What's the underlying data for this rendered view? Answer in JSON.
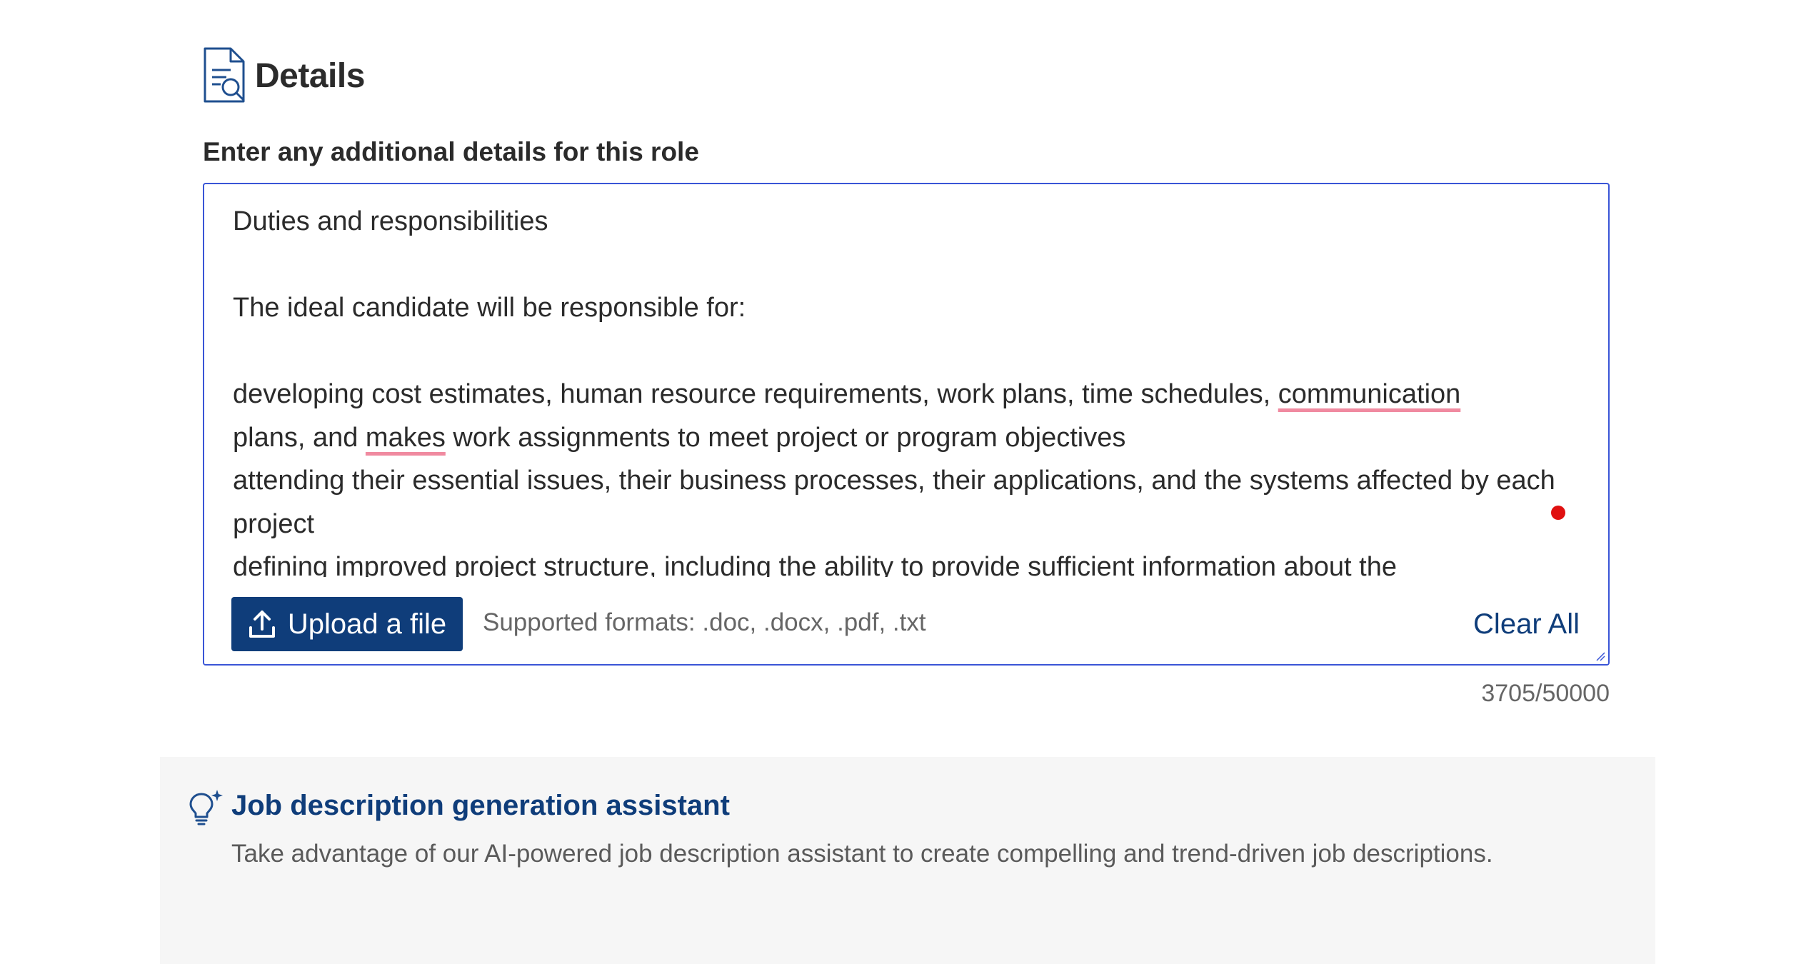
{
  "section": {
    "title": "Details",
    "icon": "document-search-icon"
  },
  "field": {
    "label": "Enter any additional details for this role"
  },
  "editor": {
    "lines": {
      "l1": "Duties and responsibilities",
      "l2": "The ideal candidate will be responsible for:",
      "l3a": "developing cost estimates, human resource requirements, work plans, time schedules, ",
      "l3b": "communication",
      "l3c": "plans, and ",
      "l3d": "makes",
      "l3e": " work assignments to meet project or program objectives",
      "l4": "attending their essential issues, their business processes, their applications, and the systems affected by each project",
      "l5": "defining improved project structure, including the ability to provide sufficient information about the"
    },
    "upload_button_label": "Upload a file",
    "upload_icon": "upload-icon",
    "supported_formats": "Supported formats: .doc, .docx, .pdf, .txt",
    "clear_all_label": "Clear All",
    "char_count": "3705/50000",
    "colors": {
      "border": "#3a55d6",
      "button": "#0f3d7a",
      "spellcheck": "#f08aa0",
      "indicator": "#e01010"
    }
  },
  "assistant": {
    "icon": "lightbulb-sparkle-icon",
    "title": "Job description generation assistant",
    "description": "Take advantage of our AI-powered job description assistant to create compelling and trend-driven job descriptions."
  }
}
